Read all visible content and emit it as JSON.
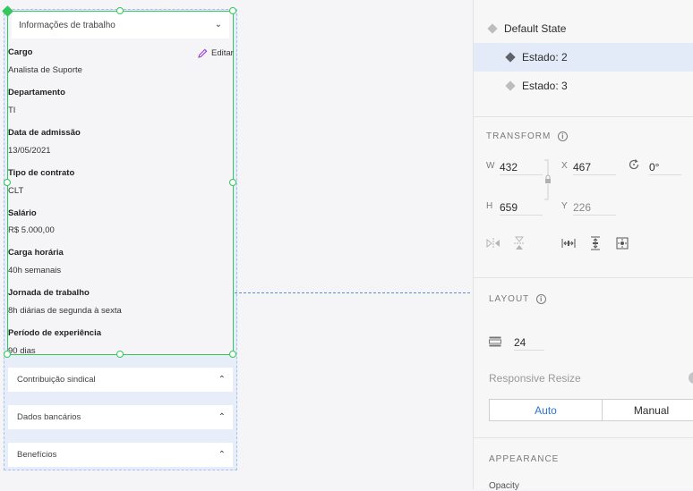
{
  "canvas": {
    "expanded_card": {
      "title": "Informações de trabalho",
      "edit_label": "Editar",
      "fields": [
        {
          "label": "Cargo",
          "value": "Analista de Suporte"
        },
        {
          "label": "Departamento",
          "value": "TI"
        },
        {
          "label": "Data de admissão",
          "value": "13/05/2021"
        },
        {
          "label": "Tipo de contrato",
          "value": "CLT"
        },
        {
          "label": "Salário",
          "value": "R$ 5.000,00"
        },
        {
          "label": "Carga horária",
          "value": "40h semanais"
        },
        {
          "label": "Jornada de trabalho",
          "value": "8h diárias de segunda à sexta"
        },
        {
          "label": "Período de experiência",
          "value": "90 dias"
        }
      ]
    },
    "collapsed_cards": [
      {
        "title": "Contribuição sindical"
      },
      {
        "title": "Dados bancários"
      },
      {
        "title": "Benefícios"
      }
    ]
  },
  "panel": {
    "states": [
      {
        "label": "Default State"
      },
      {
        "label": "Estado: 2"
      },
      {
        "label": "Estado: 3"
      }
    ],
    "transform": {
      "title": "TRANSFORM",
      "w_label": "W",
      "w_value": "432",
      "x_label": "X",
      "x_value": "467",
      "rotation_value": "0°",
      "h_label": "H",
      "h_value": "659",
      "y_label": "Y",
      "y_value": "226"
    },
    "layout": {
      "title": "LAYOUT",
      "padding_value": "24",
      "responsive_resize_label": "Responsive Resize",
      "auto_label": "Auto",
      "manual_label": "Manual"
    },
    "appearance": {
      "title": "APPEARANCE",
      "opacity_label": "Opacity"
    }
  },
  "colors": {
    "selection_green": "#34c759",
    "guide_blue": "#5a8fd6",
    "accent_blue": "#2d74d4",
    "selected_state_bg": "#e2ebf7",
    "edit_icon_purple": "#9b3fc6"
  }
}
